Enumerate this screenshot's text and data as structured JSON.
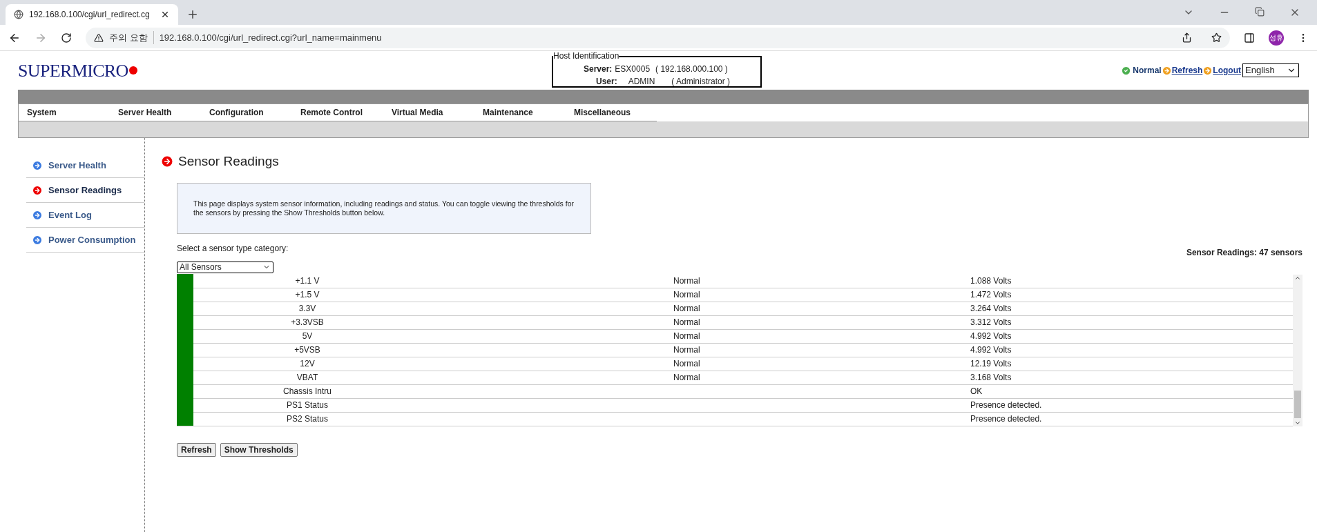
{
  "browser": {
    "tab_title": "192.168.0.100/cgi/url_redirect.cg",
    "security": "주의 요함",
    "url": "192.168.0.100/cgi/url_redirect.cgi?url_name=mainmenu",
    "profile": "성휴"
  },
  "header": {
    "logo": "SUPERMICRO",
    "host": {
      "legend": "Host Identification",
      "server_label": "Server:",
      "server": "ESX0005",
      "server_ip": "( 192.168.000.100 )",
      "user_label": "User:",
      "user": "ADMIN",
      "role": "( Administrator )"
    },
    "status": "Normal",
    "refresh": "Refresh",
    "logout": "Logout",
    "language": "English"
  },
  "menu": [
    "System",
    "Server Health",
    "Configuration",
    "Remote Control",
    "Virtual Media",
    "Maintenance",
    "Miscellaneous"
  ],
  "sidebar": {
    "items": [
      {
        "label": "Server Health",
        "selected": false
      },
      {
        "label": "Sensor Readings",
        "selected": true
      },
      {
        "label": "Event Log",
        "selected": false
      },
      {
        "label": "Power Consumption",
        "selected": false
      }
    ]
  },
  "page": {
    "title": "Sensor Readings",
    "description": "This page displays system sensor information, including readings and status. You can toggle viewing the thresholds for the sensors by pressing the Show Thresholds button below.",
    "category_label": "Select a sensor type category:",
    "category": "All Sensors",
    "count": "Sensor Readings: 47 sensors"
  },
  "rows": [
    {
      "color": "#008000",
      "name": "+1.1 V",
      "status": "Normal",
      "reading": "1.088 Volts"
    },
    {
      "color": "#008000",
      "name": "+1.5 V",
      "status": "Normal",
      "reading": "1.472 Volts"
    },
    {
      "color": "#008000",
      "name": "3.3V",
      "status": "Normal",
      "reading": "3.264 Volts"
    },
    {
      "color": "#008000",
      "name": "+3.3VSB",
      "status": "Normal",
      "reading": "3.312 Volts"
    },
    {
      "color": "#008000",
      "name": "5V",
      "status": "Normal",
      "reading": "4.992 Volts"
    },
    {
      "color": "#008000",
      "name": "+5VSB",
      "status": "Normal",
      "reading": "4.992 Volts"
    },
    {
      "color": "#008000",
      "name": "12V",
      "status": "Normal",
      "reading": "12.19 Volts"
    },
    {
      "color": "#008000",
      "name": "VBAT",
      "status": "Normal",
      "reading": "3.168 Volts"
    },
    {
      "color": "#008000",
      "name": "Chassis Intru",
      "reading": "OK"
    },
    {
      "color": "#008000",
      "name": "PS1 Status",
      "reading": "Presence detected."
    },
    {
      "color": "#008000",
      "name": "PS2 Status",
      "reading": "Presence detected."
    }
  ],
  "buttons": [
    "Refresh",
    "Show Thresholds"
  ]
}
